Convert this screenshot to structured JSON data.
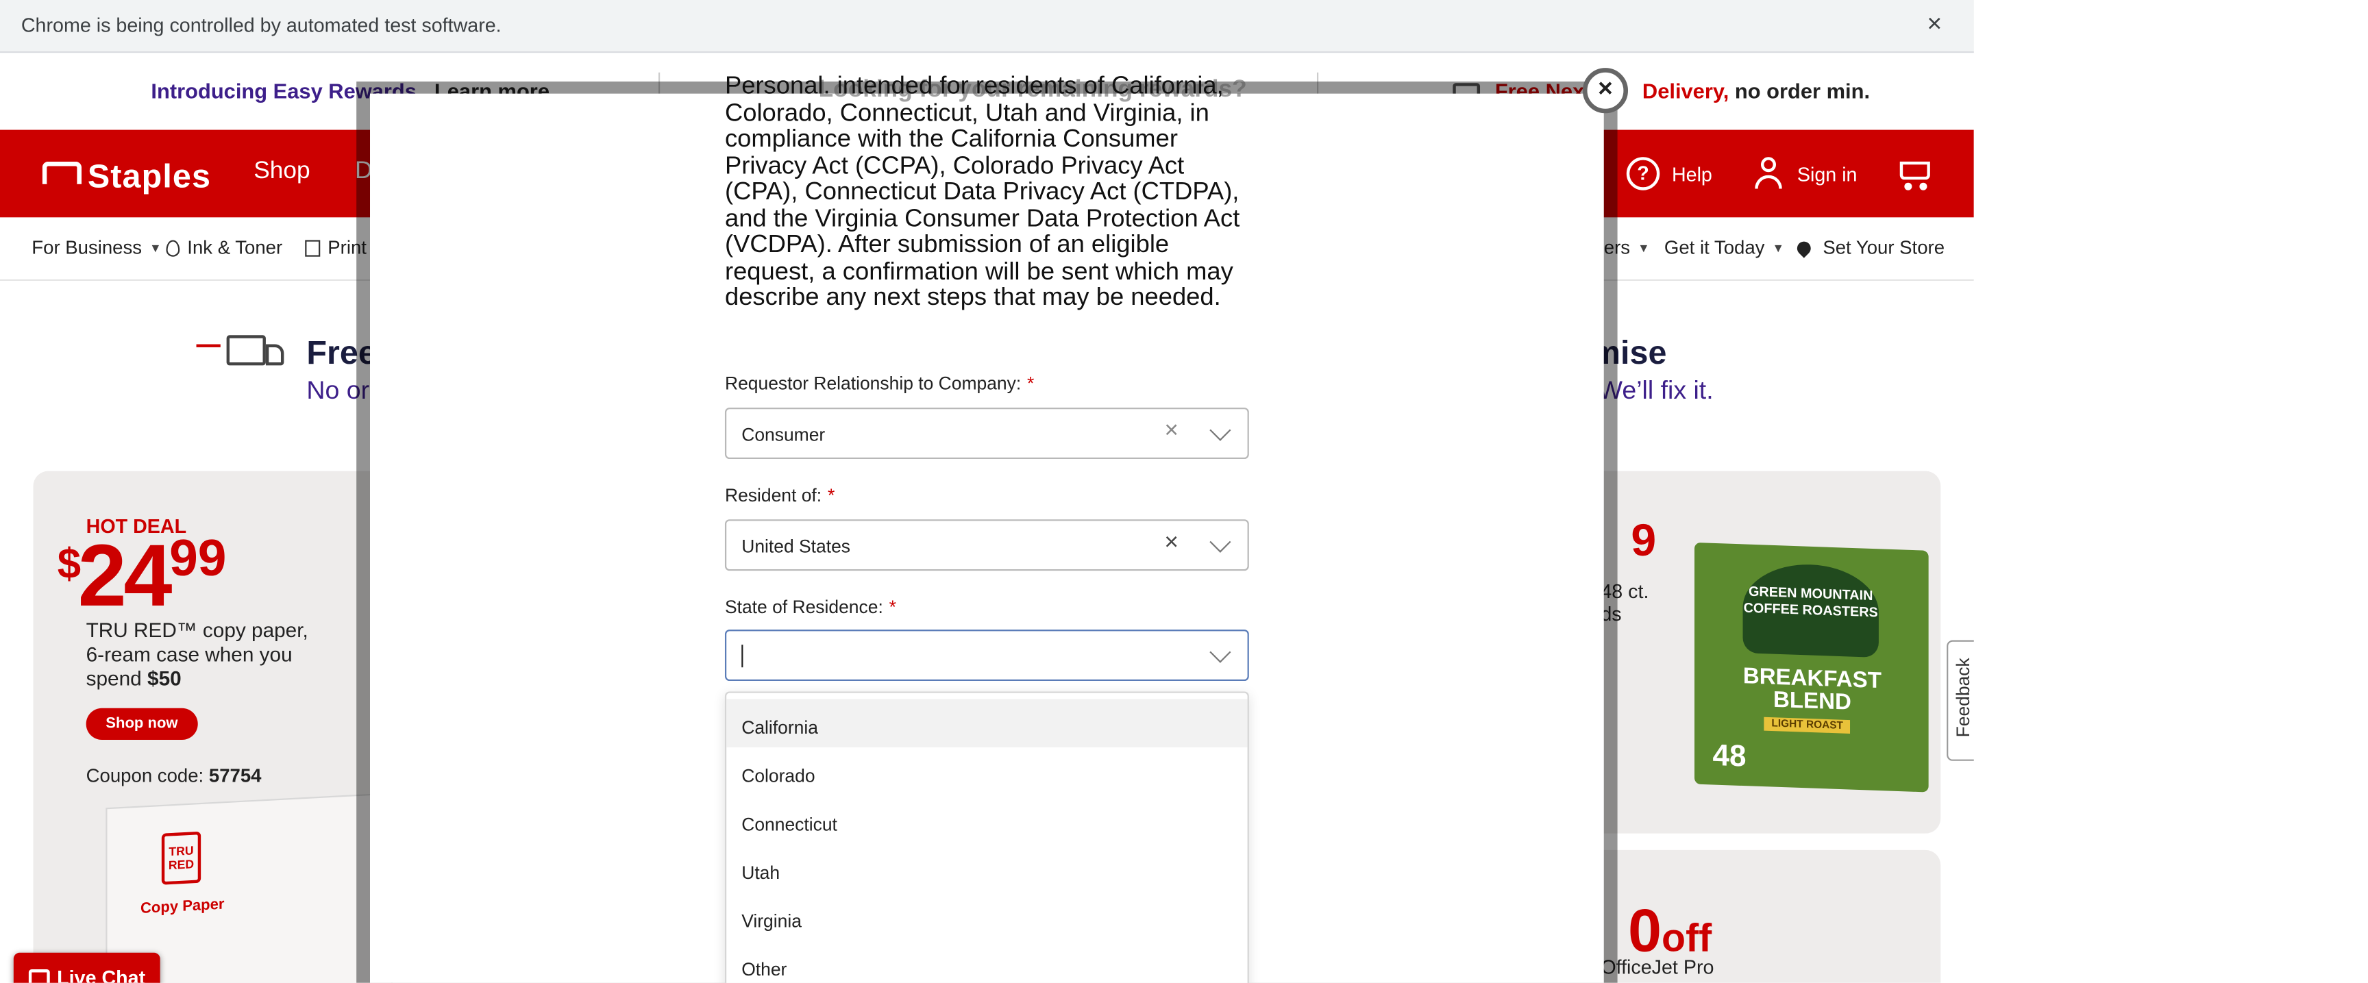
{
  "browser": {
    "automation_banner": "Chrome is being controlled by automated test software.",
    "close_glyph": "×"
  },
  "promo_bar": {
    "left_text": "Introducing Easy Rewards.",
    "learn_more": "Learn more",
    "right_red": "Free Next",
    "right_red2": "Delivery,",
    "right_text": "no order min."
  },
  "header": {
    "logo": "Staples",
    "nav_shop": "Shop",
    "nav_partial": "D",
    "help": "Help",
    "sign_in": "Sign in"
  },
  "subnav": {
    "for_business": "For Business",
    "ink_toner": "Ink & Toner",
    "print_partial": "Print",
    "partial_right": "ers",
    "get_it_today": "Get it Today",
    "set_store": "Set Your Store"
  },
  "hero": {
    "left_title": "Free",
    "left_sub": "No or",
    "right_title": "omise",
    "right_sub": "rs? We’ll fix it."
  },
  "deal_card": {
    "tag": "HOT DEAL",
    "price_dollar": "$",
    "price_main": "24",
    "price_cents": "99",
    "desc": "TRU RED™ copy paper, 6-ream case when you spend",
    "desc_amount": "$50",
    "shop_now": "Shop now",
    "coupon_label": "Coupon code:",
    "coupon_code": "57754",
    "box_brand": "TRU RED",
    "box_label": "Copy Paper"
  },
  "kcup_card": {
    "price_partial": "9",
    "desc_line1": "48 ct.",
    "desc_line2": "ds",
    "brand": "GREEN MOUNTAIN COFFEE ROASTERS",
    "product": "BREAKFAST BLEND",
    "roast": "LIGHT ROAST",
    "count": "48"
  },
  "printer_card": {
    "off_partial": "0",
    "off_label": "off",
    "sub_partial": "OfficeJet Pro"
  },
  "live_chat": {
    "label": "Live Chat"
  },
  "feedback": {
    "label": "Feedback"
  },
  "modal": {
    "ghost_heading": "Looking for your remaining rewards?",
    "paragraph": "Personal. intended for residents of California, Colorado, Connecticut, Utah and Virginia, in compliance with the California Consumer Privacy Act (CCPA), Colorado Privacy Act (CPA), Connecticut Data Privacy Act (CTDPA), and the Virginia Consumer Data Protection Act (VCDPA). After submission of an eligible request, a confirmation will be sent which may describe any next steps that may be needed.",
    "close_glyph": "×",
    "fields": {
      "relationship": {
        "label": "Requestor Relationship to Company:",
        "required": "*",
        "value": "Consumer",
        "clear": "×"
      },
      "resident": {
        "label": "Resident of:",
        "required": "*",
        "value": "United States",
        "clear": "×"
      },
      "state": {
        "label": "State of Residence:",
        "required": "*",
        "value": ""
      }
    },
    "state_options": [
      "California",
      "Colorado",
      "Connecticut",
      "Utah",
      "Virginia",
      "Other"
    ]
  },
  "colors": {
    "brand_red": "#cc0000",
    "promo_purple": "#3d1f8a",
    "focus_border": "#5a7cb8"
  }
}
